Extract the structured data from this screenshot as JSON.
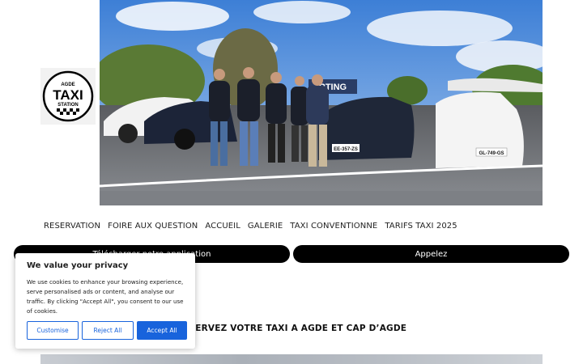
{
  "logo": {
    "alt": "Agde Taxi Station",
    "line1": "AGDE",
    "line2": "TAXI",
    "line3": "STATION"
  },
  "hero": {
    "sign_text": "RTING",
    "plate_left": "EE-357-ZS",
    "plate_right": "GL-749-GS"
  },
  "nav": [
    {
      "label": "RESERVATION"
    },
    {
      "label": "FOIRE AUX QUESTION"
    },
    {
      "label": "ACCUEIL"
    },
    {
      "label": "GALERIE"
    },
    {
      "label": "TAXI CONVENTIONNE"
    },
    {
      "label": "TARIFS TAXI 2025"
    }
  ],
  "actions": {
    "app_label": "Télécharger notre application",
    "call_label": "Appelez"
  },
  "heading": "RESERVEZ VOTRE TAXI A AGDE ET CAP D’AGDE",
  "cookie": {
    "title": "We value your privacy",
    "body": "We use cookies to enhance your browsing experience, serve personalised ads or content, and analyse our traffic. By clicking \"Accept All\", you consent to our use of cookies.",
    "customise": "Customise",
    "reject": "Reject All",
    "accept": "Accept All"
  },
  "colors": {
    "accent": "#1863dc",
    "button_bg": "#000000"
  }
}
